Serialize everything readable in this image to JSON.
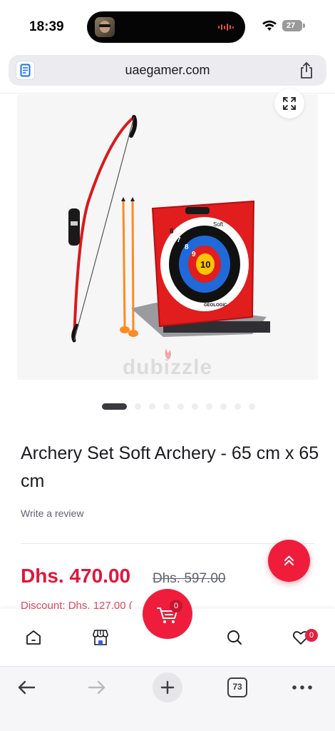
{
  "status_bar": {
    "time": "18:39",
    "battery": "27"
  },
  "browser": {
    "url": "uaegamer.com",
    "tab_count": "73"
  },
  "product": {
    "watermark": "dubizzle",
    "image_count": 10,
    "active_image": 1,
    "title": "Archery Set Soft Archery - 65 cm x 65 cm",
    "review_link": "Write a review",
    "price": "Dhs. 470.00",
    "old_price": "Dhs. 597.00",
    "discount": "Discount: Dhs. 127.00 (",
    "target_brand": "GEOLOGIC",
    "target_label": "Soft",
    "target_numbers": [
      "6",
      "7",
      "8",
      "9",
      "10"
    ]
  },
  "bottom_nav": {
    "cart_count": "0",
    "wishlist_count": "0"
  },
  "colors": {
    "accent": "#ef1d3b",
    "text": "#1b1b20",
    "muted": "#5f6170"
  }
}
